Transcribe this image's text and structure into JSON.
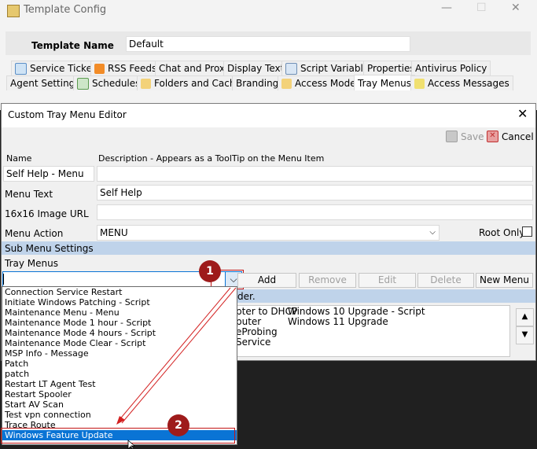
{
  "background_window": {
    "title": "Template Config",
    "template_name_label": "Template Name",
    "template_name_value": "Default",
    "tabs_row1": [
      "Service Tickets",
      "RSS Feeds",
      "Chat and Proxy",
      "Display Text",
      "Script Variables",
      "Properties",
      "Antivirus Policy"
    ],
    "tabs_row2": [
      "Agent Settings",
      "Schedules",
      "Folders and Cache",
      "Branding",
      "Access Modes",
      "Tray Menus",
      "Access Messages"
    ]
  },
  "dialog": {
    "title": "Custom Tray Menu Editor",
    "save_label": "Save",
    "cancel_label": "Cancel",
    "col_name": "Name",
    "col_description": "Description - Appears as a ToolTip on the Menu Item",
    "name_value": "Self Help - Menu",
    "description_value": "",
    "menu_text_label": "Menu Text",
    "menu_text_value": "Self Help",
    "image_url_label": "16x16 Image URL",
    "image_url_value": "",
    "menu_action_label": "Menu Action",
    "menu_action_value": "MENU",
    "root_only_label": "Root Only",
    "submenu_section": "Sub Menu Settings",
    "tray_menus_label": "Tray Menus",
    "tray_combo_value": "",
    "add_label": "Add",
    "remove_label": "Remove",
    "edit_label": "Edit",
    "delete_label": "Delete",
    "new_menu_label": "New Menu",
    "order_fragment": "der.",
    "list_col1": [
      "pter to DHCP",
      "puter",
      "eProbing",
      "Service"
    ],
    "list_col2": [
      "Windows 10 Upgrade - Script",
      "Windows 11 Upgrade"
    ]
  },
  "dropdown_items": [
    "Connection Service Restart",
    "Initiate Windows Patching - Script",
    "Maintenance Menu - Menu",
    "Maintenance Mode 1 hour - Script",
    "Maintenance Mode 4 hours - Script",
    "Maintenance Mode Clear - Script",
    "MSP Info - Message",
    "Patch",
    "patch",
    "Restart LT Agent Test",
    "Restart Spooler",
    "Start AV Scan",
    "Test vpn connection",
    "Trace Route",
    "Windows Feature Update"
  ],
  "selected_dropdown_index": 14,
  "annotations": [
    "1",
    "2"
  ],
  "colors": {
    "accent": "#0a74d5",
    "annotation": "#9e1b1b",
    "section_bar": "#bfd3ea"
  }
}
